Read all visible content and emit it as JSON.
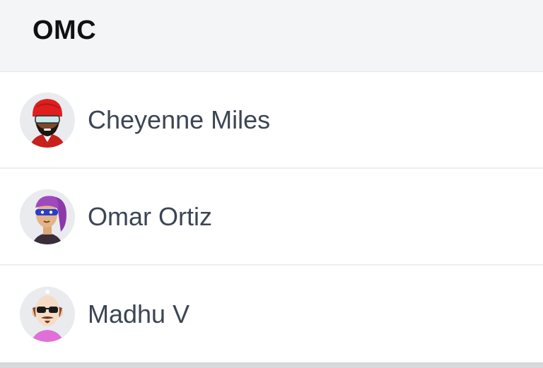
{
  "header": {
    "title": "OMC"
  },
  "contacts": [
    {
      "name": "Cheyenne Miles",
      "avatar_icon": "avatar-red-turban-sunglasses-icon"
    },
    {
      "name": "Omar Ortiz",
      "avatar_icon": "avatar-purple-hair-mask-icon"
    },
    {
      "name": "Madhu V",
      "avatar_icon": "avatar-bald-sunglasses-icon"
    }
  ],
  "colors": {
    "header_bg": "#f4f5f6",
    "name_text": "#3c4554",
    "divider": "#eceef0",
    "avatar_bg": "#e9ebee"
  }
}
